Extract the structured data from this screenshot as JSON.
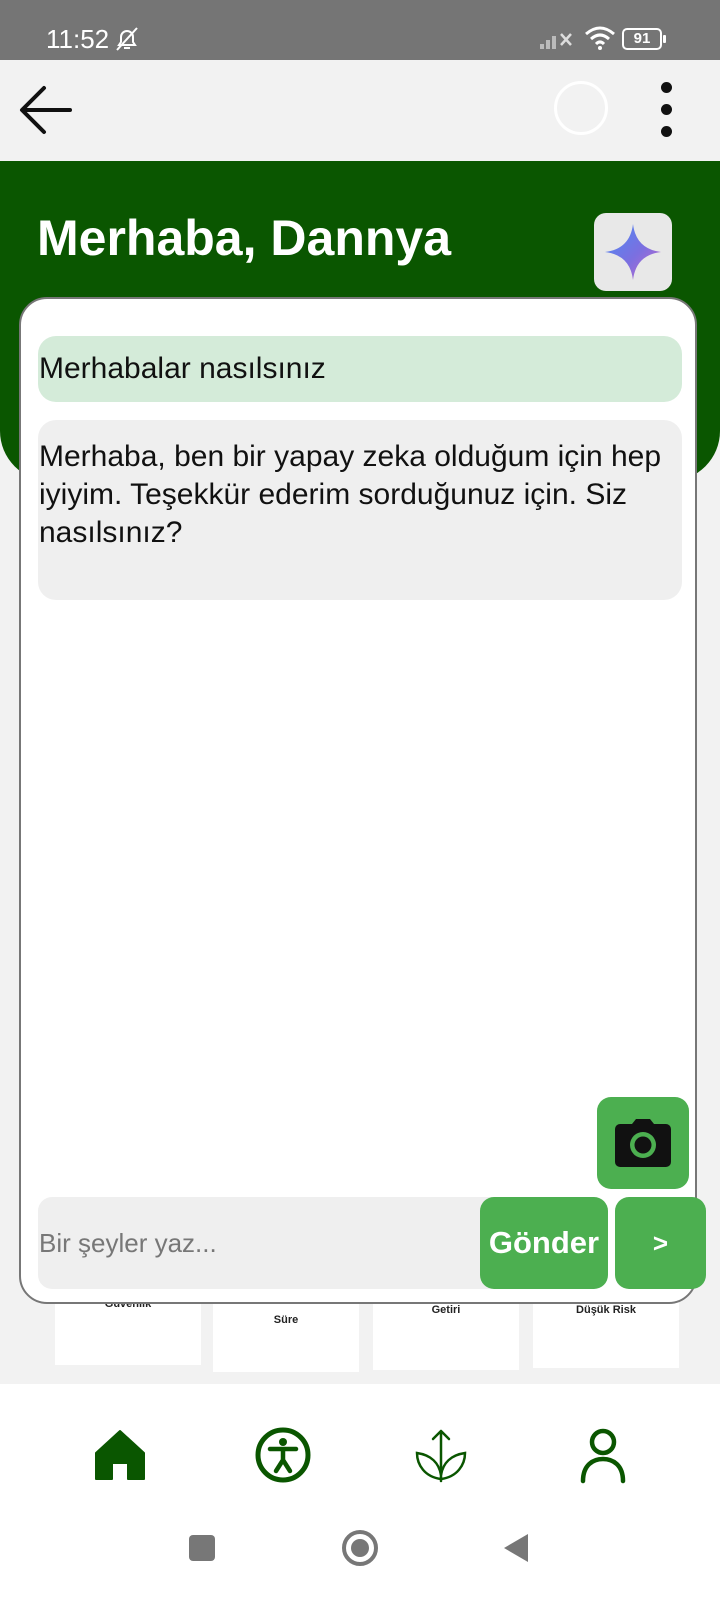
{
  "status_bar": {
    "time": "11:52",
    "battery": "91",
    "icons": [
      "bell-off-icon",
      "signal-icon",
      "wifi-icon",
      "battery-icon"
    ]
  },
  "app_bar": {
    "icons": [
      "back-arrow-icon",
      "loading-circle",
      "more-vert-icon"
    ]
  },
  "header": {
    "greeting": "Merhaba, Dannya",
    "ai_icon": "sparkle-icon",
    "background_color": "#0a5600"
  },
  "chat": {
    "messages": [
      {
        "role": "user",
        "text": "Merhabalar nasılsınız"
      },
      {
        "role": "assistant",
        "text": "Merhaba, ben bir yapay zeka olduğum için hep iyiyim. Teşekkür ederim sorduğunuz için. Siz nasılsınız?"
      }
    ],
    "input": {
      "placeholder": "Bir şeyler yaz...",
      "value": ""
    },
    "send_label": "Gönder",
    "next_label": ">",
    "camera_icon": "camera-icon",
    "accent_color": "#4caf50"
  },
  "background_cards": [
    {
      "label": "Güvenlik"
    },
    {
      "label": "Süre"
    },
    {
      "label": "Getiri"
    },
    {
      "label": "Düşük Risk"
    }
  ],
  "bottom_nav": {
    "items": [
      "home-icon",
      "accessibility-icon",
      "sprout-icon",
      "profile-icon"
    ],
    "color": "#0a5600"
  },
  "system_nav": [
    "recents-icon",
    "home-circle-icon",
    "back-triangle-icon"
  ]
}
